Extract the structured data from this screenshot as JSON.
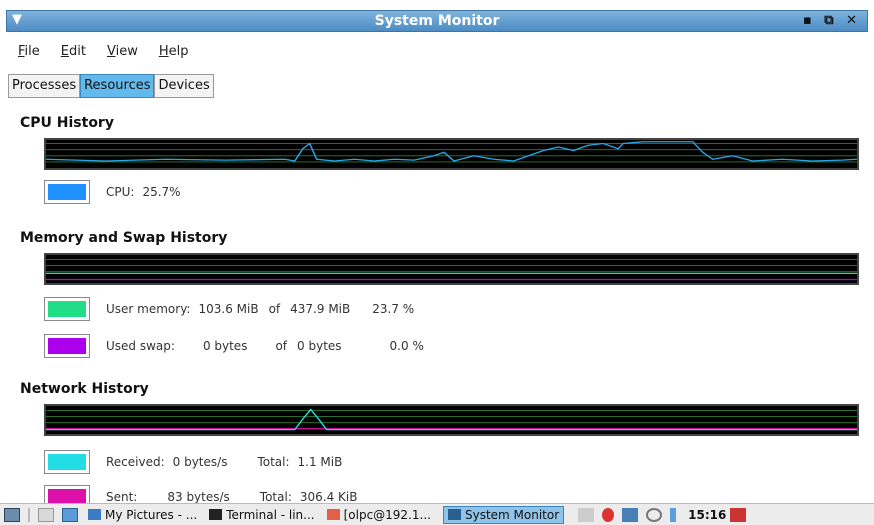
{
  "window": {
    "title": "System Monitor",
    "menu_arrow": "▼",
    "controls": "▪ ⧉ ✕"
  },
  "menu": [
    {
      "first": "F",
      "rest": "ile"
    },
    {
      "first": "E",
      "rest": "dit"
    },
    {
      "first": "V",
      "rest": "iew"
    },
    {
      "first": "H",
      "rest": "elp"
    }
  ],
  "tabs": [
    "Processes",
    "Resources",
    "Devices"
  ],
  "cpu": {
    "title": "CPU History",
    "label": "CPU:",
    "value": "25.7%",
    "color": "#1e90ff"
  },
  "memory": {
    "title": "Memory and Swap History",
    "user_label": "User memory:",
    "user_used": "103.6 MiB",
    "user_of": "of",
    "user_total": "437.9 MiB",
    "user_percent": "23.7 %",
    "user_color": "#22dd88",
    "swap_label": "Used swap:",
    "swap_used": "0 bytes",
    "swap_of": "of",
    "swap_total": "0 bytes",
    "swap_percent": "0.0 %",
    "swap_color": "#aa00ee"
  },
  "network": {
    "title": "Network History",
    "recv_label": "Received:",
    "recv_rate": "0 bytes/s",
    "recv_total_label": "Total:",
    "recv_total": "1.1 MiB",
    "recv_color": "#22dde6",
    "sent_label": "Sent:",
    "sent_rate": "83 bytes/s",
    "sent_total_label": "Total:",
    "sent_total": "306.4 KiB",
    "sent_color": "#dd11aa"
  },
  "taskbar": {
    "tasks": [
      "My Pictures - ...",
      "Terminal - lin...",
      "[olpc@192.1...",
      "System Monitor"
    ],
    "clock": "15:16"
  }
}
